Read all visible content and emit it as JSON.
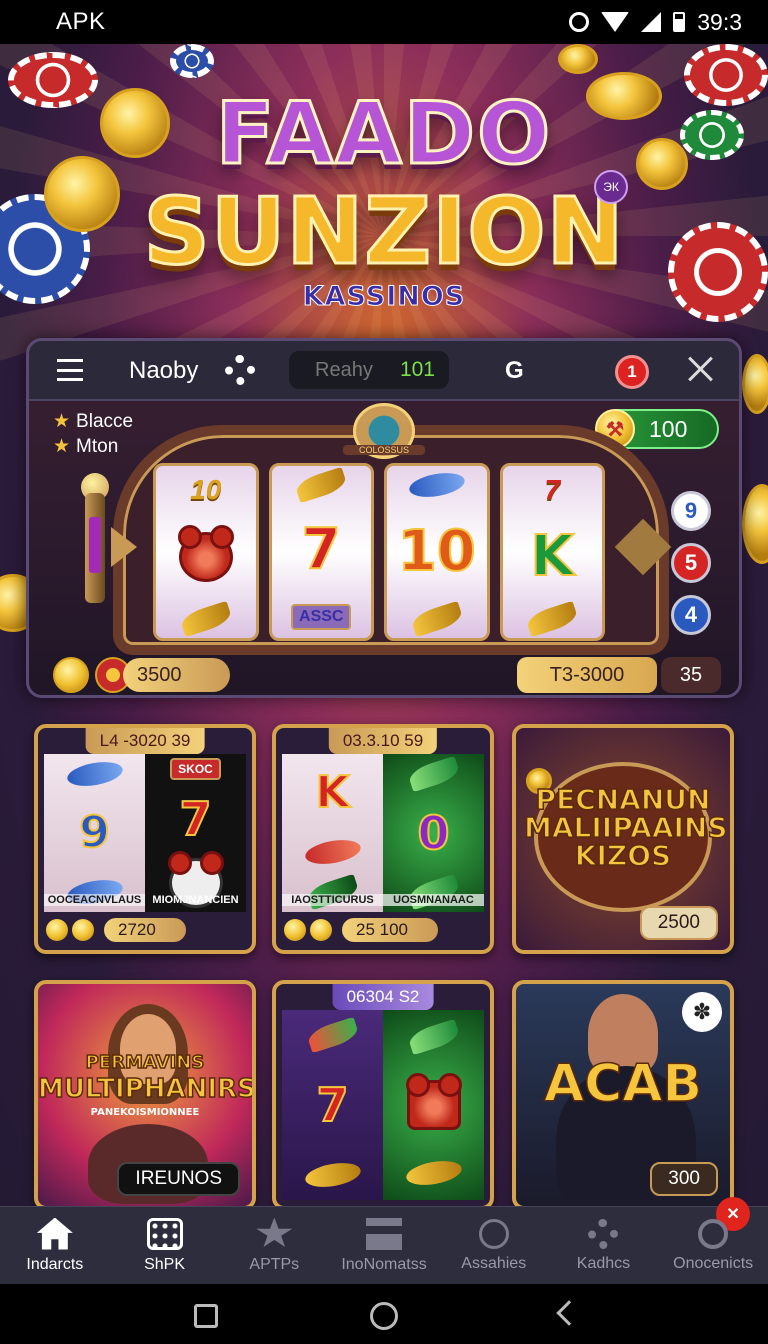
{
  "status_bar": {
    "carrier": "APK",
    "time": "39:3"
  },
  "hero": {
    "logo_line1": "FAADO",
    "logo_line2": "SUNZION",
    "logo_line3": "KASSINOS",
    "logo_badge": "ЭК"
  },
  "slot_panel": {
    "name": "Naoby",
    "search_placeholder": "Reahy",
    "search_count": "101",
    "g_label": "G",
    "notification_count": "1",
    "stars": [
      "Blacce",
      "Mton"
    ],
    "coin_balance": "100",
    "crest_label": "COLOSSUS",
    "reels": [
      {
        "top": "10",
        "middle": "bear",
        "bottom": "leaf"
      },
      {
        "top": "leaf",
        "middle": "7",
        "bottom": "ASSC"
      },
      {
        "top": "fish",
        "middle": "10",
        "bottom": "fish"
      },
      {
        "top": "7",
        "middle": "K",
        "bottom": "leaf"
      }
    ],
    "side_numbers": [
      "9",
      "5",
      "4"
    ],
    "balance": "3500",
    "total": "T3-3000",
    "bet": "35"
  },
  "games": [
    {
      "tag": "L4 -3020  39",
      "left_caption": "OOCEACNVLAUS",
      "right_caption": "MIOMJNANCIEN",
      "right_badge": "SKOC",
      "footer_value": "2720"
    },
    {
      "tag": "03.3.10  59",
      "left_caption": "IAOSTTICURUS",
      "right_caption": "UOSMNANAAC",
      "footer_value": "25 100"
    },
    {
      "title": "PECNANUN MALIIPAAINS KIZOS",
      "badge": "2500"
    },
    {
      "title_small": "PERMAVINS",
      "title": "MULTIPHANIRS",
      "subtitle": "PANEKOISMIONNEE",
      "badge": "IREUNOS"
    },
    {
      "tag": "06304  S2"
    },
    {
      "title": "ACAB",
      "badge": "300"
    }
  ],
  "bottom_nav": {
    "items": [
      {
        "label": "Indarcts",
        "icon": "home-icon"
      },
      {
        "label": "ShPK",
        "icon": "grid-icon"
      },
      {
        "label": "APTPs",
        "icon": "star-icon"
      },
      {
        "label": "InoNomatss",
        "icon": "bar-icon"
      },
      {
        "label": "Assahies",
        "icon": "ring-icon"
      },
      {
        "label": "Kadhcs",
        "icon": "cog-icon"
      },
      {
        "label": "Onocenicts",
        "icon": "search-icon"
      }
    ],
    "badge": "✕"
  },
  "colors": {
    "accent_gold": "#f3d27a",
    "panel_bg": "#2c2a3a",
    "nav_bg": "#2e2d3d",
    "badge_red": "#e0241e"
  }
}
